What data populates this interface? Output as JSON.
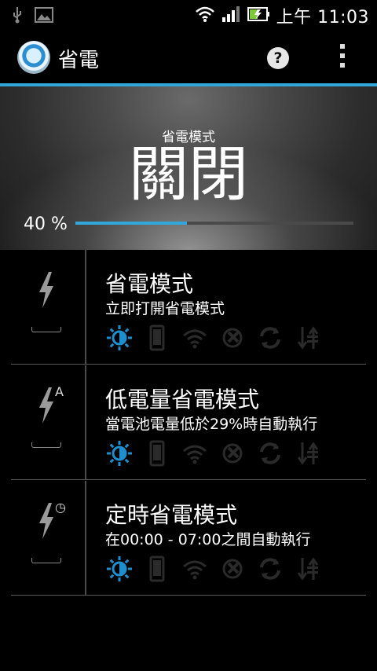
{
  "statusbar": {
    "time": "上午 11:03",
    "icons": [
      "usb-icon",
      "image-icon",
      "wifi-icon",
      "signal-icon",
      "battery-icon"
    ]
  },
  "appbar": {
    "title": "省電",
    "help_label": "?",
    "icons": [
      "app-logo-icon",
      "help-icon",
      "overflow-menu-icon"
    ]
  },
  "hero": {
    "label": "省電模式",
    "status": "關閉",
    "battery_percent_text": "40 %",
    "battery_level": 0.4
  },
  "colors": {
    "accent": "#31a6d9",
    "active_feature": "#1e8fce",
    "inactive_feature": "#2a2a2a"
  },
  "modes": [
    {
      "title": "省電模式",
      "subtitle": "立即打開省電模式",
      "badge": "",
      "icon": "bolt-icon"
    },
    {
      "title": "低電量省電模式",
      "subtitle": "當電池電量低於29%時自動執行",
      "badge": "A",
      "icon": "bolt-auto-icon"
    },
    {
      "title": "定時省電模式",
      "subtitle": "在00:00 - 07:00之間自動執行",
      "badge": "◷",
      "icon": "bolt-clock-icon"
    }
  ],
  "feature_icons": [
    "brightness-icon",
    "screen-timeout-icon",
    "wifi-icon",
    "gps-icon",
    "sync-icon",
    "data-icon"
  ]
}
